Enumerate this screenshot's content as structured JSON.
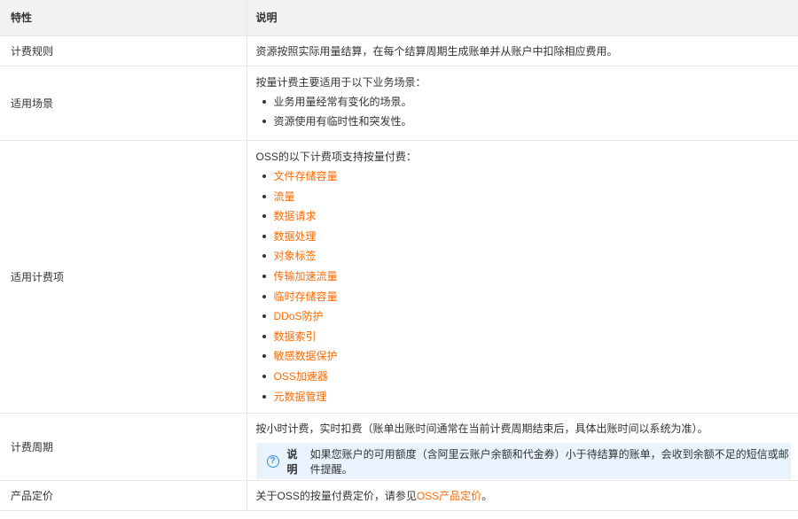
{
  "header": {
    "col1": "特性",
    "col2": "说明"
  },
  "rows": {
    "billing_rule": {
      "label": "计费规则",
      "text": "资源按照实际用量结算，在每个结算周期生成账单并从账户中扣除相应费用。"
    },
    "scenario": {
      "label": "适用场景",
      "intro": "按量计费主要适用于以下业务场景：",
      "items": [
        "业务用量经常有变化的场景。",
        "资源使用有临时性和突发性。"
      ]
    },
    "billing_items": {
      "label": "适用计费项",
      "intro": "OSS的以下计费项支持按量付费：",
      "items": [
        "文件存储容量",
        "流量",
        "数据请求",
        "数据处理",
        "对象标签",
        "传输加速流量",
        "临时存储容量",
        "DDoS防护",
        "数据索引",
        "敏感数据保护",
        "OSS加速器",
        "元数据管理"
      ]
    },
    "billing_cycle": {
      "label": "计费周期",
      "text": "按小时计费，实时扣费（账单出账时间通常在当前计费周期结束后，具体出账时间以系统为准）。",
      "note": {
        "icon": "question-circle-icon",
        "title": "说明",
        "text": "如果您账户的可用额度（含阿里云账户余额和代金券）小于待结算的账单，会收到余额不足的短信或邮件提醒。"
      }
    },
    "pricing": {
      "label": "产品定价",
      "text_before": "关于OSS的按量付费定价，请参见",
      "link": "OSS产品定价",
      "text_after": "。"
    }
  },
  "colors": {
    "link": "#ff6a00",
    "header_bg": "#f2f2f2",
    "note_bg": "#e8f3fd",
    "note_icon": "#3b8ede"
  }
}
